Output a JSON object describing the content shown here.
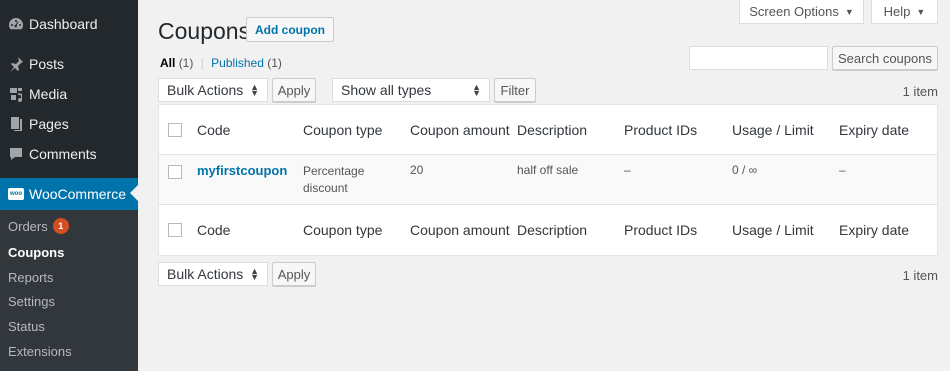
{
  "sidebar": {
    "items": [
      {
        "label": "Dashboard",
        "icon": "dashboard-icon"
      },
      {
        "label": "Posts",
        "icon": "pin-icon"
      },
      {
        "label": "Media",
        "icon": "media-icon"
      },
      {
        "label": "Pages",
        "icon": "pages-icon"
      },
      {
        "label": "Comments",
        "icon": "comment-icon"
      },
      {
        "label": "WooCommerce",
        "icon": "woo-icon"
      }
    ],
    "woo_icon_text": "woo",
    "submenu": [
      {
        "label": "Orders",
        "badge": "1"
      },
      {
        "label": "Coupons"
      },
      {
        "label": "Reports"
      },
      {
        "label": "Settings"
      },
      {
        "label": "Status"
      },
      {
        "label": "Extensions"
      }
    ]
  },
  "top": {
    "screen_options": "Screen Options",
    "help": "Help",
    "caret": "▼"
  },
  "page": {
    "title": "Coupons",
    "add_button": "Add coupon"
  },
  "filters": {
    "all": "All",
    "all_count": "(1)",
    "sep": "|",
    "published": "Published",
    "published_count": "(1)"
  },
  "search": {
    "button": "Search coupons",
    "value": ""
  },
  "tablenav": {
    "bulk_actions": "Bulk Actions",
    "apply": "Apply",
    "types": "Show all types",
    "filter": "Filter",
    "count": "1 item"
  },
  "table": {
    "columns": {
      "code": "Code",
      "type": "Coupon type",
      "amount": "Coupon amount",
      "description": "Description",
      "product_ids": "Product IDs",
      "usage": "Usage / Limit",
      "expiry": "Expiry date"
    },
    "rows": [
      {
        "code": "myfirstcoupon",
        "type": "Percentage discount",
        "amount": "20",
        "description": "half off sale",
        "product_ids": "–",
        "usage": "0 / ∞",
        "expiry": "–"
      }
    ]
  }
}
